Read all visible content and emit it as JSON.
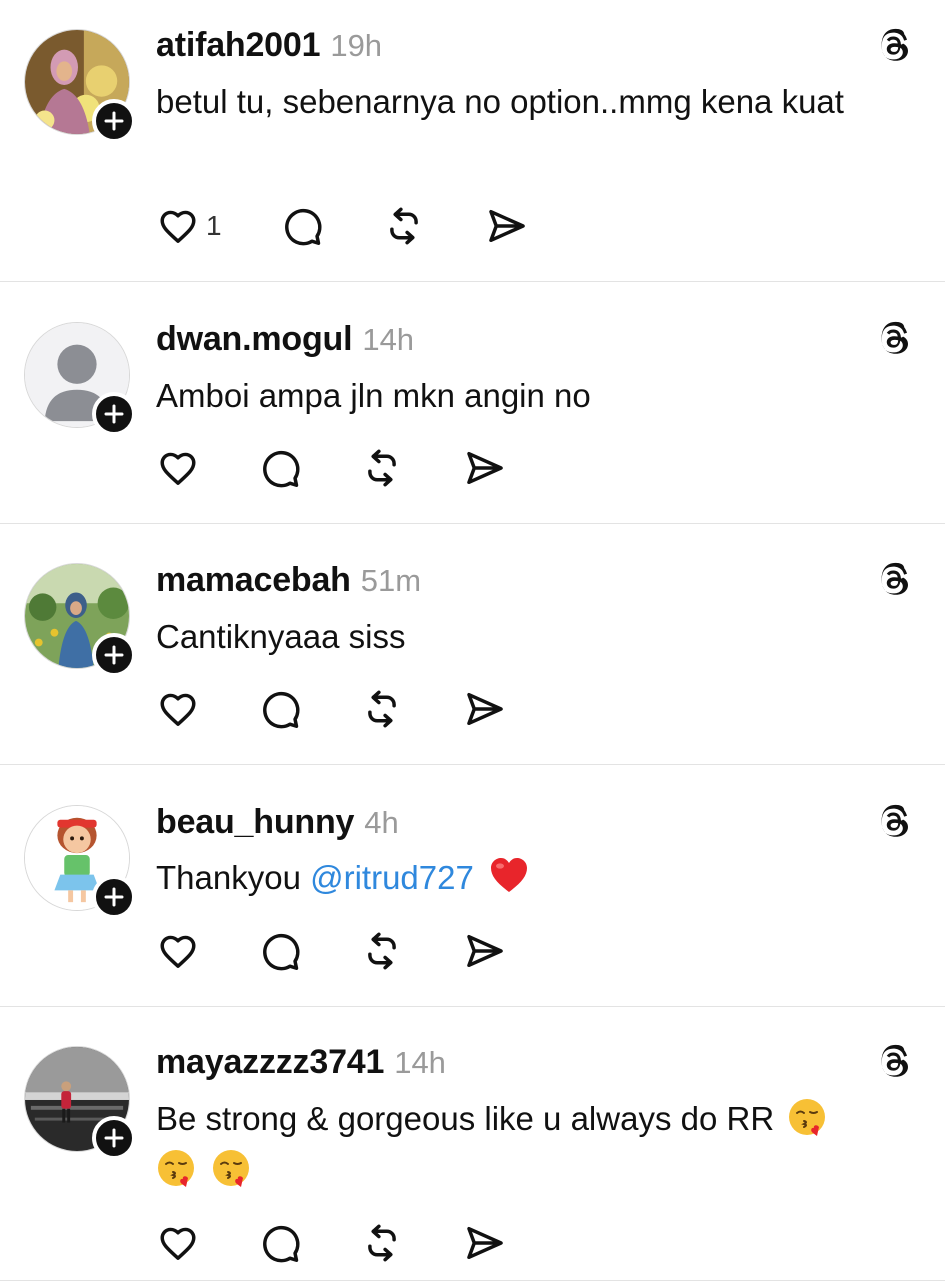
{
  "posts": [
    {
      "username": "atifah2001",
      "time": "19h",
      "text": "betul tu, sebenarnya no option..mmg kena kuat",
      "like_count": "1",
      "avatar": "hijab-woman-food-photo"
    },
    {
      "username": "dwan.mogul",
      "time": "14h",
      "text": "Amboi ampa jln mkn angin no",
      "like_count": "",
      "avatar": "default-profile-silhouette"
    },
    {
      "username": "mamacebah",
      "time": "51m",
      "text": "Cantiknyaaa siss",
      "like_count": "",
      "avatar": "woman-in-garden-photo"
    },
    {
      "username": "beau_hunny",
      "time": "4h",
      "text_before": "Thankyou ",
      "mention": "@ritrud727",
      "emoji": "red-heart",
      "like_count": "",
      "avatar": "cartoon-girl"
    },
    {
      "username": "mayazzzz3741",
      "time": "14h",
      "text_line1": "Be strong & gorgeous like u always do RR",
      "emojis": [
        "kissing-face-with-heart",
        "kissing-face-with-heart",
        "kissing-face-with-heart"
      ],
      "like_count": "",
      "avatar": "dark-grayscale-photo"
    }
  ],
  "icons": {
    "like": "heart-icon",
    "comment": "comment-bubble-icon",
    "repost": "repost-icon",
    "share": "send-icon",
    "follow": "plus-icon",
    "brand": "threads-logo-icon"
  },
  "colors": {
    "mention": "#2f88dd",
    "timestamp": "#9a9a9a",
    "divider": "#e3e3e3",
    "badge": "#111111"
  }
}
